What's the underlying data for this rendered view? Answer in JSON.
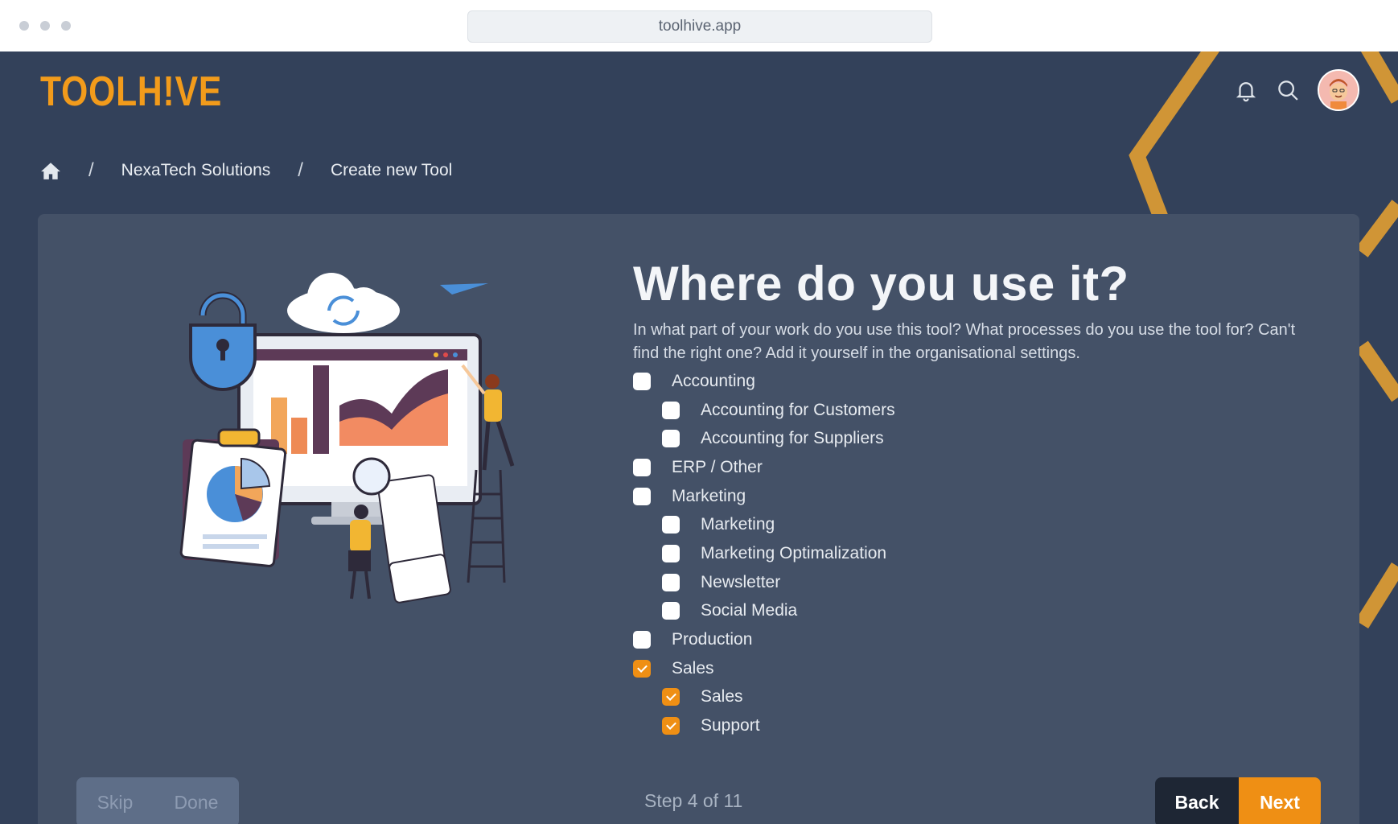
{
  "browser": {
    "url": "toolhive.app"
  },
  "app": {
    "logo_text": "TOOLH!VE"
  },
  "icons": {
    "bell": "bell-icon",
    "search": "search-icon",
    "home": "home-icon"
  },
  "breadcrumb": {
    "sep": "/",
    "items": [
      "NexaTech Solutions",
      "Create new Tool"
    ]
  },
  "page": {
    "title": "Where do you use it?",
    "description": "In what part of your work do you use this tool? What processes do you use the tool for? Can't find the right one? Add it yourself in the organisational settings."
  },
  "options": [
    {
      "label": "Accounting",
      "level": 0,
      "checked": false
    },
    {
      "label": "Accounting for Customers",
      "level": 1,
      "checked": false
    },
    {
      "label": "Accounting for Suppliers",
      "level": 1,
      "checked": false
    },
    {
      "label": "ERP / Other",
      "level": 0,
      "checked": false
    },
    {
      "label": "Marketing",
      "level": 0,
      "checked": false
    },
    {
      "label": "Marketing",
      "level": 1,
      "checked": false
    },
    {
      "label": "Marketing Optimalization",
      "level": 1,
      "checked": false
    },
    {
      "label": "Newsletter",
      "level": 1,
      "checked": false
    },
    {
      "label": "Social Media",
      "level": 1,
      "checked": false
    },
    {
      "label": "Production",
      "level": 0,
      "checked": false
    },
    {
      "label": "Sales",
      "level": 0,
      "checked": true
    },
    {
      "label": "Sales",
      "level": 1,
      "checked": true
    },
    {
      "label": "Support",
      "level": 1,
      "checked": true
    }
  ],
  "footer": {
    "skip": "Skip",
    "done": "Done",
    "step": "Step 4 of 11",
    "back": "Back",
    "next": "Next"
  },
  "colors": {
    "accent": "#ef8f14",
    "background": "#33415a",
    "card": "#445167",
    "dark_button": "#1e2634"
  }
}
